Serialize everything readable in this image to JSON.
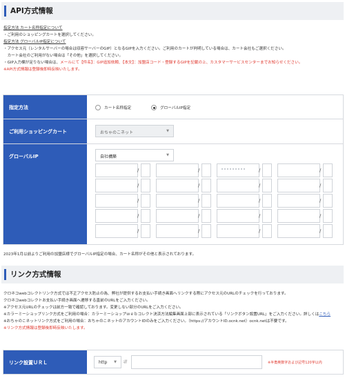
{
  "api_section": {
    "title": "API方式情報",
    "notes": [
      "指定方法 カート名称指定について",
      "・ご利用のショッピングカートを選択してください。",
      "指定方法 グローバルIP指定について",
      "・アクセス元（レンタルサーバーの場合は収容サーバーのGIP）となるGIPを入力ください。ご利用のカートが判明している場合は、カート会社もご選択ください。",
      "　カート会社のご利用がない場合は「その他」を選択してください。",
      "・GIP入力欄が足りない場合は、",
      "メールにて【件名】：GIP追加依頼、【本文】：加盟店コード・登録するGIPを記載の上、カスタマーサービスセンターまでお知らせください。",
      "※API方式情報は登録後即時反映いたします。"
    ],
    "method": {
      "label": "指定方法",
      "option_cart": "カート名称指定",
      "option_ip": "グローバルIP指定",
      "selected": "option_ip"
    },
    "cart": {
      "label": "ご利用ショッピングカート",
      "value": "おちゃのこネット",
      "disabled": true
    },
    "global_ip": {
      "label": "グローバルIP",
      "type_value": "自社構築",
      "rows": [
        [
          "",
          "",
          "",
          "",
          "",
          "",
          "",
          ""
        ],
        [
          "",
          "",
          "",
          "",
          "",
          "",
          "",
          ""
        ],
        [
          "",
          "",
          "",
          "",
          "",
          "",
          "",
          ""
        ],
        [
          "",
          "",
          "",
          "",
          "",
          "",
          "",
          ""
        ],
        [
          "",
          "",
          "",
          "",
          "",
          "",
          "",
          ""
        ]
      ]
    },
    "footnote": "2023年1月以前よりご利用の加盟店様でグローバルIP指定の場合、カート名称がその他と表示されております。"
  },
  "link_section": {
    "title": "リンク方式情報",
    "notes": [
      "クロネコwebコレクトリンク方式では不正アクセス防止の為、弊社が提供するお支払い手続き画面へリンクする際にアクセス元のURLのチェックを行っております。",
      "クロネコwebコレクトお支払い手続き画面へ遷移する直前のURLをご入力ください。",
      "※アクセス元URLのチェックは前方一致で確認しております。変更しない部分のURLをご入力ください。",
      "※カラーミーショップリンク方式をご利用の場合：カラーミーショップｗｅｂコレクト決済方法編集画面上部に表示されている「リンクボタン設置URL」をご入力ください。詳しくは",
      "こちら",
      "※おちゃのこネットリンク方式をご利用の場合：おちゃのこネットのアカウントIDのみをご入力ください。（https://アカウントID.ocnk.net）ocnk.netは不要です。",
      "※リンク方式情報は登録後即時反映いたします。"
    ],
    "url": {
      "label": "リンク設置ＵＲＬ",
      "protocol": "http",
      "separator": "://",
      "value": "",
      "hint": "※半角英数字および記号120字以内"
    }
  }
}
